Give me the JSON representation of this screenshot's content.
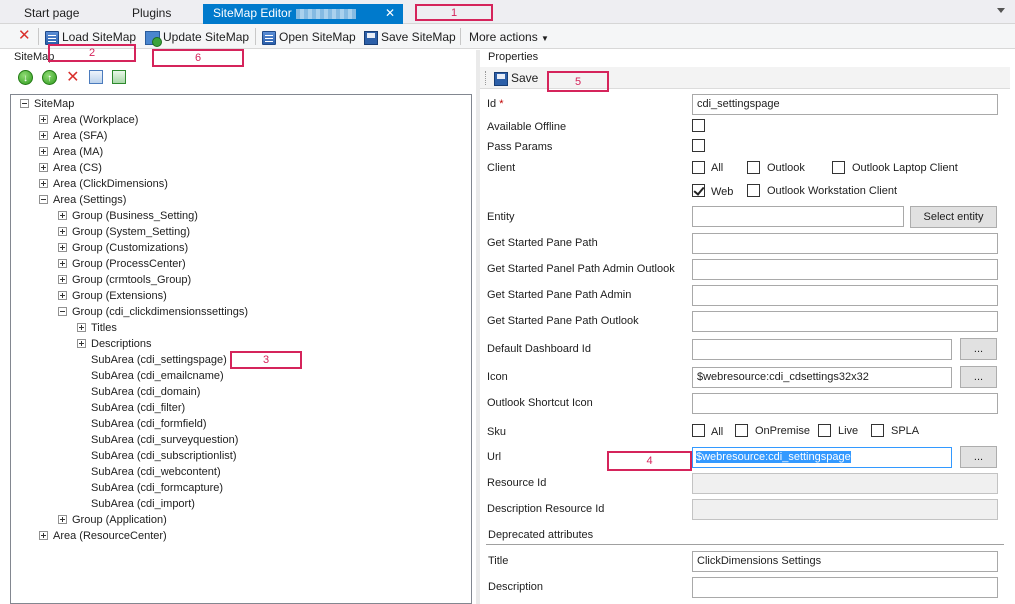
{
  "tabs": [
    {
      "label": "Start page"
    },
    {
      "label": "Plugins"
    },
    {
      "label": "SiteMap Editor",
      "close": "✕"
    }
  ],
  "toolbar": {
    "load_label": "Load SiteMap",
    "update_label": "Update SiteMap",
    "open_label": "Open SiteMap",
    "save_label": "Save SiteMap",
    "more_label": "More actions"
  },
  "left": {
    "section_label": "SiteMap",
    "tree": [
      {
        "label": "SiteMap",
        "depth": 0,
        "expander": "minus"
      },
      {
        "label": "Area (Workplace)",
        "depth": 1,
        "expander": "plus"
      },
      {
        "label": "Area (SFA)",
        "depth": 1,
        "expander": "plus"
      },
      {
        "label": "Area (MA)",
        "depth": 1,
        "expander": "plus"
      },
      {
        "label": "Area (CS)",
        "depth": 1,
        "expander": "plus"
      },
      {
        "label": "Area (ClickDimensions)",
        "depth": 1,
        "expander": "plus"
      },
      {
        "label": "Area (Settings)",
        "depth": 1,
        "expander": "minus"
      },
      {
        "label": "Group (Business_Setting)",
        "depth": 2,
        "expander": "plus"
      },
      {
        "label": "Group (System_Setting)",
        "depth": 2,
        "expander": "plus"
      },
      {
        "label": "Group (Customizations)",
        "depth": 2,
        "expander": "plus"
      },
      {
        "label": "Group (ProcessCenter)",
        "depth": 2,
        "expander": "plus"
      },
      {
        "label": "Group (crmtools_Group)",
        "depth": 2,
        "expander": "plus"
      },
      {
        "label": "Group (Extensions)",
        "depth": 2,
        "expander": "plus"
      },
      {
        "label": "Group (cdi_clickdimensionssettings)",
        "depth": 2,
        "expander": "minus"
      },
      {
        "label": "Titles",
        "depth": 3,
        "expander": "plus"
      },
      {
        "label": "Descriptions",
        "depth": 3,
        "expander": "plus"
      },
      {
        "label": "SubArea (cdi_settingspage)",
        "depth": 3,
        "expander": "none"
      },
      {
        "label": "SubArea (cdi_emailcname)",
        "depth": 3,
        "expander": "none"
      },
      {
        "label": "SubArea (cdi_domain)",
        "depth": 3,
        "expander": "none"
      },
      {
        "label": "SubArea (cdi_filter)",
        "depth": 3,
        "expander": "none"
      },
      {
        "label": "SubArea (cdi_formfield)",
        "depth": 3,
        "expander": "none"
      },
      {
        "label": "SubArea (cdi_surveyquestion)",
        "depth": 3,
        "expander": "none"
      },
      {
        "label": "SubArea (cdi_subscriptionlist)",
        "depth": 3,
        "expander": "none"
      },
      {
        "label": "SubArea (cdi_webcontent)",
        "depth": 3,
        "expander": "none"
      },
      {
        "label": "SubArea (cdi_formcapture)",
        "depth": 3,
        "expander": "none"
      },
      {
        "label": "SubArea (cdi_import)",
        "depth": 3,
        "expander": "none"
      },
      {
        "label": "Group (Application)",
        "depth": 2,
        "expander": "plus"
      },
      {
        "label": "Area (ResourceCenter)",
        "depth": 1,
        "expander": "plus"
      }
    ]
  },
  "properties": {
    "section_label": "Properties",
    "save_label": "Save",
    "id_label": "Id",
    "required_mark": "*",
    "id_value": "cdi_settingspage",
    "available_offline_label": "Available Offline",
    "pass_params_label": "Pass Params",
    "client_label": "Client",
    "client_options": {
      "all": "All",
      "outlook": "Outlook",
      "outlook_laptop": "Outlook Laptop Client",
      "web": "Web",
      "outlook_workstation": "Outlook Workstation Client"
    },
    "entity_label": "Entity",
    "select_entity_label": "Select entity",
    "get_started_pane_path_label": "Get Started Pane Path",
    "get_started_panel_path_admin_outlook_label": "Get Started Panel Path Admin Outlook",
    "get_started_pane_path_admin_label": "Get Started Pane Path Admin",
    "get_started_pane_path_outlook_label": "Get Started Pane Path Outlook",
    "default_dashboard_id_label": "Default Dashboard Id",
    "browse_label": "...",
    "icon_label": "Icon",
    "icon_value": "$webresource:cdi_cdsettings32x32",
    "outlook_shortcut_icon_label": "Outlook Shortcut Icon",
    "sku_label": "Sku",
    "sku_options": {
      "all": "All",
      "onpremise": "OnPremise",
      "live": "Live",
      "spla": "SPLA"
    },
    "url_label": "Url",
    "url_value": "$webresource:cdi_settingspage",
    "resource_id_label": "Resource Id",
    "description_resource_id_label": "Description Resource Id",
    "deprecated_label": "Deprecated attributes",
    "title_label": "Title",
    "title_value": "ClickDimensions Settings",
    "description_label": "Description"
  },
  "callouts": {
    "c1": "1",
    "c2": "2",
    "c3": "3",
    "c4": "4",
    "c5": "5",
    "c6": "6"
  },
  "colors": {
    "tab_active": "#007acc",
    "callout": "#d5245b",
    "selection": "#3399ff"
  }
}
